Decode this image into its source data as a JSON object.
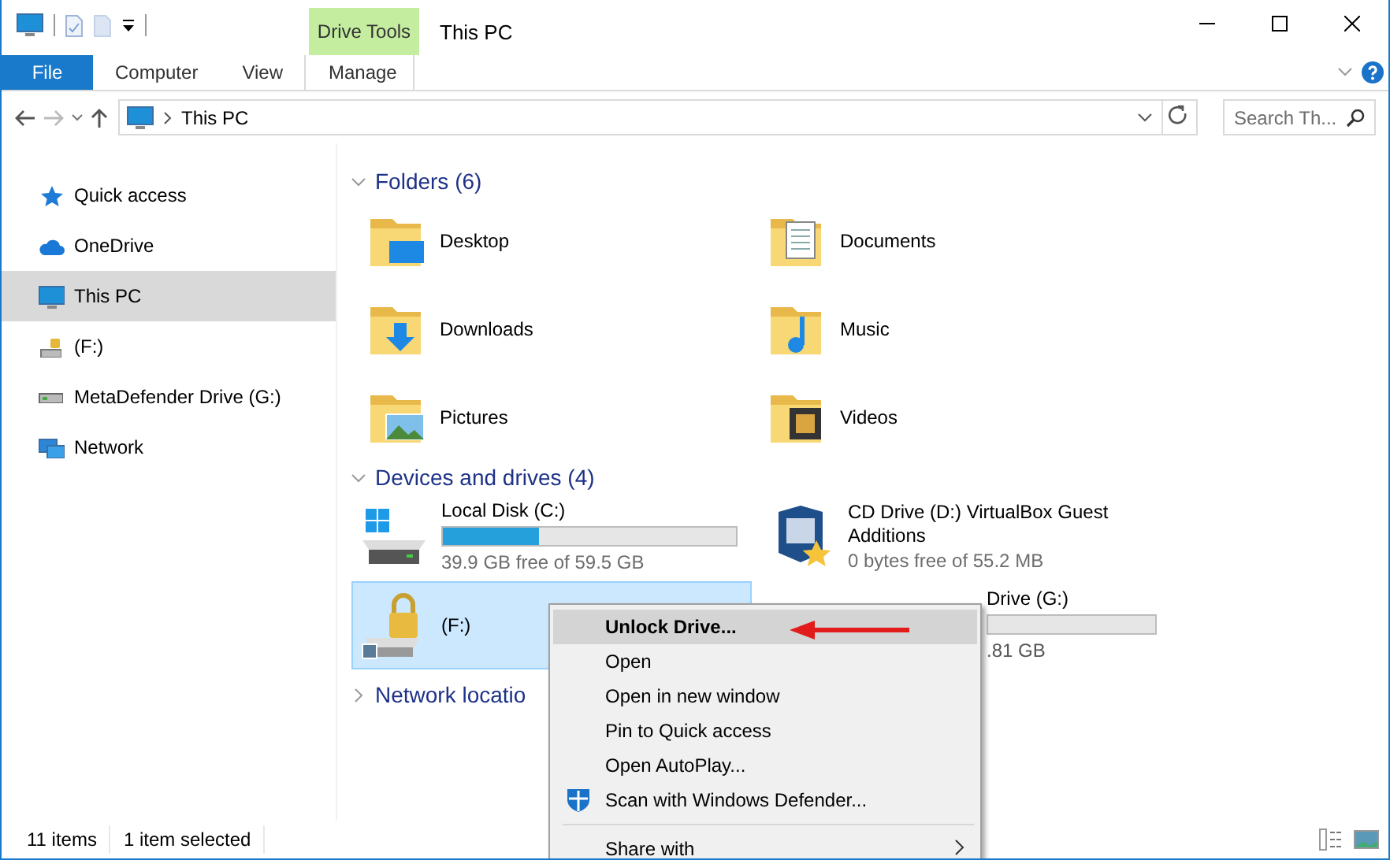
{
  "window": {
    "title": "This PC"
  },
  "ribbon": {
    "context_group": "Drive Tools",
    "tabs": [
      {
        "label": "File",
        "kind": "file",
        "selected": false
      },
      {
        "label": "Computer",
        "kind": "plain",
        "selected": false
      },
      {
        "label": "View",
        "kind": "plain",
        "selected": false
      },
      {
        "label": "Manage",
        "kind": "context",
        "selected": false
      }
    ]
  },
  "address_bar": {
    "path": "This PC"
  },
  "search": {
    "placeholder": "Search Th..."
  },
  "sidebar": {
    "items": [
      {
        "label": "Quick access",
        "kind": "star",
        "selected": false
      },
      {
        "label": "OneDrive",
        "kind": "cloud",
        "selected": false
      },
      {
        "label": "This PC",
        "kind": "monitor",
        "selected": true
      },
      {
        "label": "(F:)",
        "kind": "locked-drive",
        "selected": false
      },
      {
        "label": "MetaDefender Drive (G:)",
        "kind": "drive",
        "selected": false
      },
      {
        "label": "Network",
        "kind": "network",
        "selected": false
      }
    ]
  },
  "folders": {
    "heading": "Folders (6)",
    "items": [
      {
        "name": "Desktop",
        "kind": "desktop"
      },
      {
        "name": "Documents",
        "kind": "documents"
      },
      {
        "name": "Downloads",
        "kind": "downloads"
      },
      {
        "name": "Music",
        "kind": "music"
      },
      {
        "name": "Pictures",
        "kind": "pictures"
      },
      {
        "name": "Videos",
        "kind": "videos"
      }
    ]
  },
  "devices": {
    "heading": "Devices and drives (4)",
    "items": [
      {
        "name": "Local Disk (C:)",
        "kind": "windows-disk",
        "level": 0.33,
        "free": "39.9 GB free of 59.5 GB",
        "selected": false
      },
      {
        "name": "CD Drive (D:) VirtualBox Guest Additions",
        "kind": "cd",
        "free": "0 bytes free of 55.2 MB",
        "selected": false
      },
      {
        "name": "(F:)",
        "kind": "locked",
        "selected": true
      },
      {
        "name": "Drive (G:)",
        "kind": "covered",
        "free": ".81 GB",
        "selected": false
      }
    ]
  },
  "network": {
    "heading": "Network locatio"
  },
  "context_menu": {
    "items": [
      {
        "label": "Unlock Drive...",
        "kind": "default",
        "selected": true
      },
      {
        "label": "Open",
        "kind": "plain",
        "selected": false
      },
      {
        "label": "Open in new window",
        "kind": "plain",
        "selected": false
      },
      {
        "label": "Pin to Quick access",
        "kind": "plain",
        "selected": false
      },
      {
        "label": "Open AutoPlay...",
        "kind": "plain",
        "selected": false
      },
      {
        "label": "Scan with Windows Defender...",
        "kind": "defender",
        "selected": false
      },
      {
        "kind": "separator"
      },
      {
        "label": "Share with",
        "kind": "submenu",
        "selected": false
      }
    ]
  },
  "status_bar": {
    "items": [
      "11 items",
      "1 item selected"
    ]
  }
}
